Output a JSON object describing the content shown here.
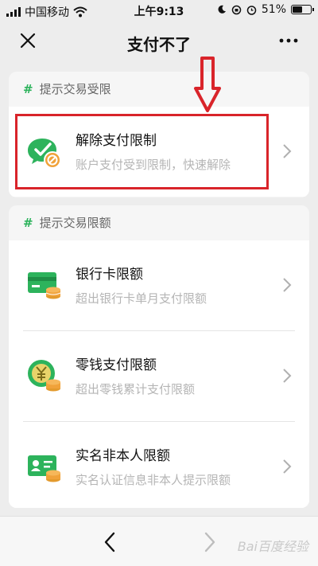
{
  "status_bar": {
    "carrier": "中国移动",
    "time": "上午9:13",
    "battery": "51%",
    "battery_level": 0.51
  },
  "nav": {
    "title": "支付不了",
    "close_icon": "close-icon",
    "more_icon": "more-icon"
  },
  "section1": {
    "hash": "#",
    "title": "提示交易受限",
    "items": [
      {
        "title": "解除支付限制",
        "subtitle": "账户支付受到限制，快速解除",
        "icon": "chat-restricted-icon"
      }
    ]
  },
  "section2": {
    "hash": "#",
    "title": "提示交易限额",
    "items": [
      {
        "title": "银行卡限额",
        "subtitle": "超出银行卡单月支付限额",
        "icon": "bank-card-coins-icon"
      },
      {
        "title": "零钱支付限额",
        "subtitle": "超出零钱累计支付限额",
        "icon": "yuan-coin-icon"
      },
      {
        "title": "实名非本人限额",
        "subtitle": "实名认证信息非本人提示限额",
        "icon": "id-card-coins-icon"
      }
    ]
  },
  "bottom": {
    "watermark": "Bai百度经验"
  },
  "colors": {
    "accent_green": "#2db35c",
    "highlight_red": "#d9242a"
  }
}
